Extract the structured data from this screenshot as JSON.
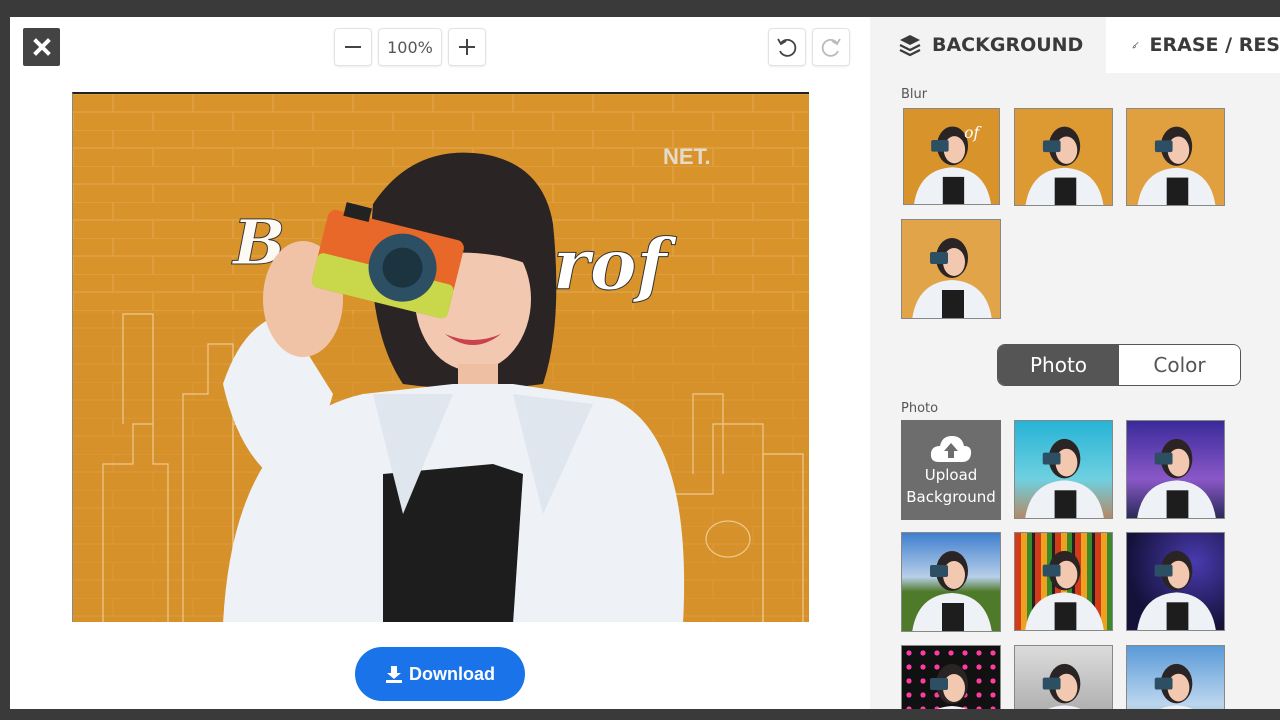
{
  "toolbar": {
    "zoom_value": "100%"
  },
  "actions": {
    "download_label": "Download"
  },
  "panel": {
    "tabs": [
      {
        "label": "BACKGROUND",
        "icon": "layers-icon"
      },
      {
        "label": "ERASE / RES",
        "icon": "brush-icon"
      }
    ],
    "blur_label": "Blur",
    "segment": {
      "photo": "Photo",
      "color": "Color"
    },
    "photo_label": "Photo",
    "upload_label_line1": "Upload",
    "upload_label_line2": "Background"
  },
  "colors": {
    "accent": "#1a73e8",
    "dark": "#444444",
    "segment_active": "#555555"
  }
}
